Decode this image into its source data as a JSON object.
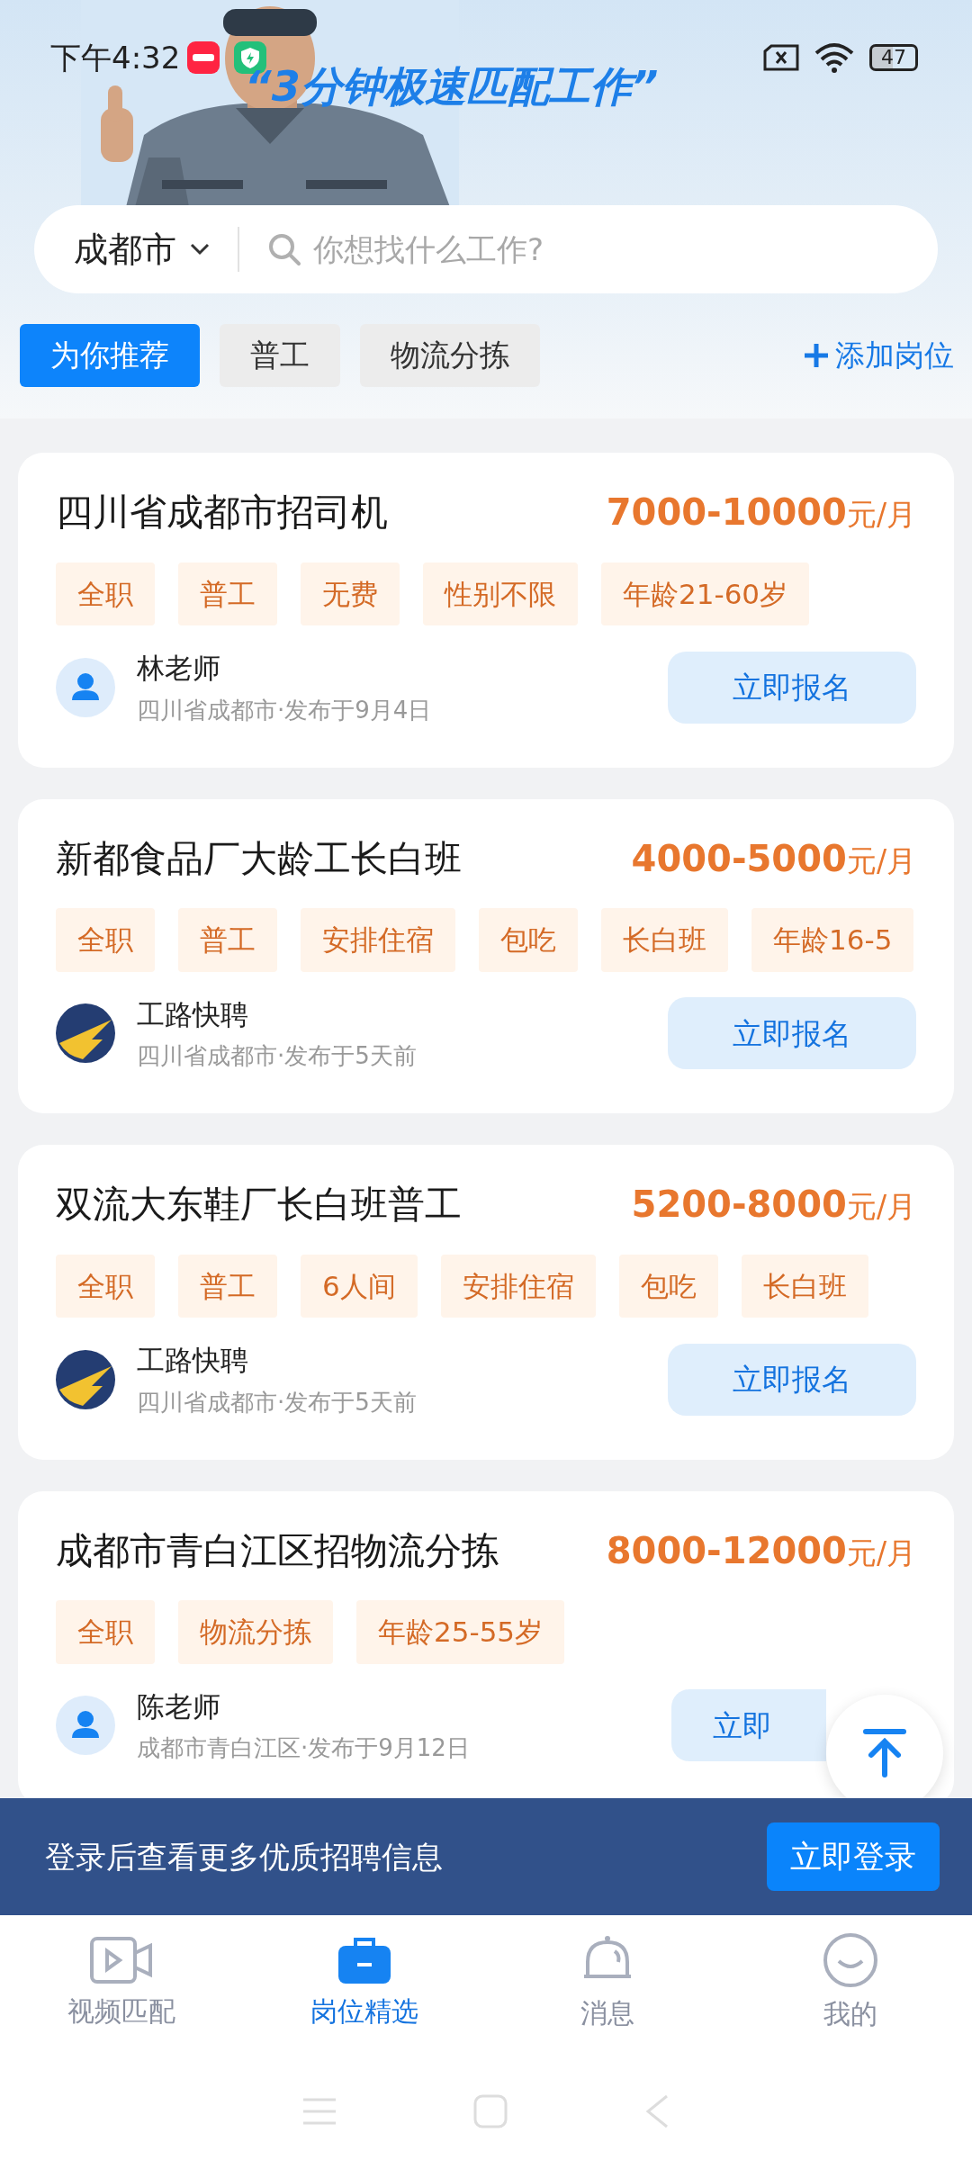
{
  "status_bar": {
    "time": "下午4:32",
    "battery": "47"
  },
  "banner": {
    "headline": "“3分钟极速匹配工作”",
    "kind": "picture"
  },
  "search": {
    "city": "成都市",
    "placeholder": "你想找什么工作?"
  },
  "filters": [
    {
      "label": "为你推荐",
      "selected": true
    },
    {
      "label": "普工",
      "selected": false
    },
    {
      "label": "物流分拣",
      "selected": false
    }
  ],
  "add_position": "添加岗位",
  "jobs": [
    {
      "title": "四川省成都市招司机",
      "salary": "7000-10000",
      "unit": "元/月",
      "tags": [
        "全职",
        "普工",
        "无费",
        "性别不限",
        "年龄21-60岁"
      ],
      "poster": {
        "name": "林老师",
        "kind": "person"
      },
      "meta": "四川省成都市·发布于9月4日",
      "button": "立即报名"
    },
    {
      "title": "新都食品厂大龄工长白班",
      "salary": "4000-5000",
      "unit": "元/月",
      "tags": [
        "全职",
        "普工",
        "安排住宿",
        "包吃",
        "长白班",
        "年龄16-5"
      ],
      "poster": {
        "name": "工路快聘",
        "kind": "logo"
      },
      "meta": "四川省成都市·发布于5天前",
      "button": "立即报名"
    },
    {
      "title": "双流大东鞋厂长白班普工",
      "salary": "5200-8000",
      "unit": "元/月",
      "tags": [
        "全职",
        "普工",
        "6人间",
        "安排住宿",
        "包吃",
        "长白班"
      ],
      "poster": {
        "name": "工路快聘",
        "kind": "logo"
      },
      "meta": "四川省成都市·发布于5天前",
      "button": "立即报名"
    },
    {
      "title": "成都市青白江区招物流分拣",
      "salary": "8000-12000",
      "unit": "元/月",
      "tags": [
        "全职",
        "物流分拣",
        "年龄25-55岁"
      ],
      "poster": {
        "name": "陈老师",
        "kind": "person"
      },
      "meta": "成都市青白江区·发布于9月12日",
      "button": "立即"
    }
  ],
  "login_banner": {
    "text": "登录后查看更多优质招聘信息",
    "button": "立即登录"
  },
  "tab_bar": [
    {
      "label": "视频匹配",
      "selected": false
    },
    {
      "label": "岗位精选",
      "selected": true
    },
    {
      "label": "消息",
      "selected": false
    },
    {
      "label": "我的",
      "selected": false
    }
  ]
}
